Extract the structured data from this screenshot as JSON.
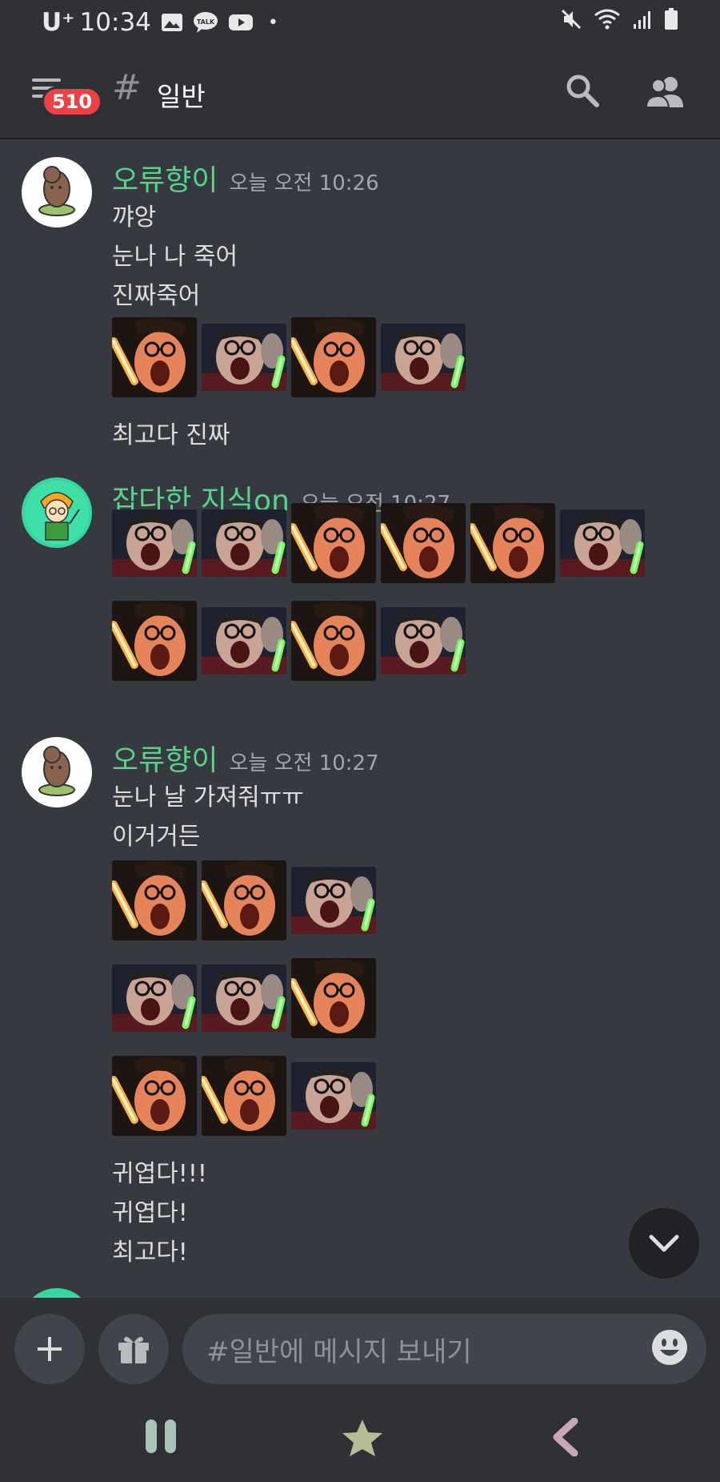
{
  "status_bar": {
    "carrier": "U⁺",
    "time": "10:34",
    "dot": "•"
  },
  "header": {
    "badge": "510",
    "hash": "#",
    "title": "일반"
  },
  "messages": [
    {
      "user": "오류향이",
      "timestamp": "오늘 오전 10:26",
      "lines": [
        "꺄앙",
        "눈나 나 죽어",
        "진짜죽어"
      ],
      "after": "최고다 진짜"
    },
    {
      "user": "잡다한 지식on",
      "timestamp": "오늘 오전 10:27"
    },
    {
      "user": "오류향이",
      "timestamp": "오늘 오전 10:27",
      "lines": [
        "눈나 날 가져줘ㅠㅠ",
        "이거거든"
      ],
      "after": [
        "귀엽다!!!",
        "귀엽다!",
        "최고다!"
      ]
    }
  ],
  "composer": {
    "placeholder": "#일반에 메시지 보내기"
  },
  "colors": {
    "background": "#36393f",
    "header": "#2f3136",
    "username": "#57d38c",
    "badge": "#ed4245"
  }
}
